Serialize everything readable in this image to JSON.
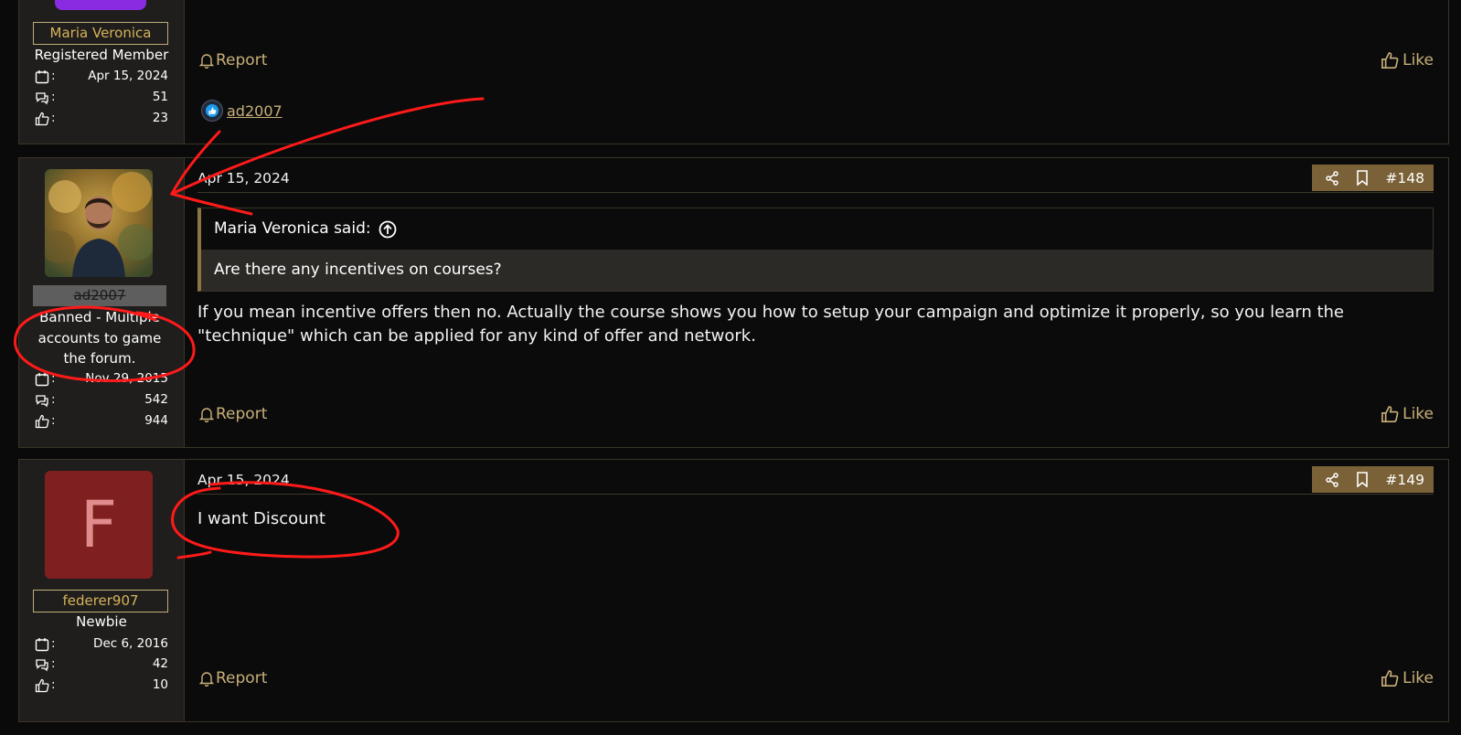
{
  "posts": [
    {
      "username": "Maria Veronica",
      "role": "Registered Member",
      "joined": "Apr 15, 2024",
      "messages": "51",
      "reactions": "23",
      "report_label": "Report",
      "like_label": "Like",
      "liked_by": "ad2007"
    },
    {
      "username": "ad2007",
      "banned_text": "Banned - Multiple accounts to game the forum.",
      "joined": "Nov 29, 2015",
      "messages": "542",
      "reactions": "944",
      "date": "Apr 15, 2024",
      "post_number": "#148",
      "quote_author": "Maria Veronica said:",
      "quote_text": "Are there any incentives on courses?",
      "body": "If you mean incentive offers then no. Actually the course shows you how to setup your campaign and optimize it properly, so you learn the \"technique\" which can be applied for any kind of offer and network.",
      "report_label": "Report",
      "like_label": "Like"
    },
    {
      "username": "federer907",
      "avatar_letter": "F",
      "role": "Newbie",
      "joined": "Dec 6, 2016",
      "messages": "42",
      "reactions": "10",
      "date": "Apr 15, 2024",
      "post_number": "#149",
      "body": "I want Discount",
      "report_label": "Report",
      "like_label": "Like"
    }
  ],
  "colors": {
    "accent_gold": "#c9b07a",
    "toolbar_brown": "#7a6137",
    "annotation_red": "#ff0000",
    "avatar_f_bg": "#7f1f1f"
  }
}
